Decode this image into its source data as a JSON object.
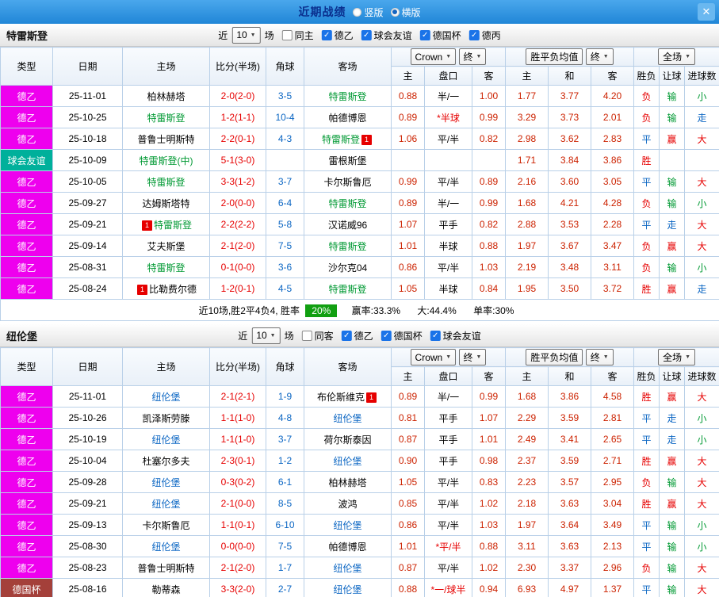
{
  "titlebar": {
    "title": "近期战绩",
    "radios": [
      {
        "label": "竖版",
        "checked": false
      },
      {
        "label": "横版",
        "checked": true
      }
    ],
    "close_label": "✕"
  },
  "columns": {
    "type": "类型",
    "date": "日期",
    "home": "主场",
    "score": "比分(半场)",
    "corner": "角球",
    "away": "客场",
    "company": "Crown",
    "final": "终",
    "europe": "胜平负均值",
    "full": "全场",
    "o_home": "主",
    "o_hcp": "盘口",
    "o_away": "客",
    "e_home": "主",
    "e_draw": "和",
    "e_away": "客",
    "r1": "胜负",
    "r2": "让球",
    "r3": "进球数"
  },
  "sections": [
    {
      "team": "特雷斯登",
      "filters": {
        "near": "近",
        "count": "10",
        "games": "场",
        "checks": [
          {
            "label": "同主",
            "on": false
          },
          {
            "label": "德乙",
            "on": true
          },
          {
            "label": "球会友谊",
            "on": true
          },
          {
            "label": "德国杯",
            "on": true
          },
          {
            "label": "德丙",
            "on": true
          }
        ]
      },
      "rows": [
        {
          "type": "德乙",
          "tc": "de2",
          "date": "25-11-01",
          "home": {
            "n": "柏林赫塔"
          },
          "score": "2-0(2-0)",
          "corner": "3-5",
          "away": {
            "n": "特雷斯登",
            "c": "team-home"
          },
          "ah": [
            "0.88",
            "半/一",
            "1.00"
          ],
          "eu": [
            "1.77",
            "3.77",
            "4.20"
          ],
          "res": [
            [
              "负",
              "r"
            ],
            [
              "输",
              "g"
            ],
            [
              "小",
              "g"
            ]
          ]
        },
        {
          "type": "德乙",
          "tc": "de2",
          "date": "25-10-25",
          "home": {
            "n": "特雷斯登",
            "c": "team-home"
          },
          "score": "1-2(1-1)",
          "corner": "10-4",
          "away": {
            "n": "帕德博恩"
          },
          "ah": [
            "0.89",
            "*半球",
            "0.99"
          ],
          "eu": [
            "3.29",
            "3.73",
            "2.01"
          ],
          "res": [
            [
              "负",
              "r"
            ],
            [
              "输",
              "g"
            ],
            [
              "走",
              "b"
            ]
          ]
        },
        {
          "type": "德乙",
          "tc": "de2",
          "date": "25-10-18",
          "home": {
            "n": "普鲁士明斯特"
          },
          "score": "2-2(0-1)",
          "corner": "4-3",
          "away": {
            "n": "特雷斯登",
            "c": "team-home",
            "b": "1",
            "bp": "after"
          },
          "ah": [
            "1.06",
            "平/半",
            "0.82"
          ],
          "eu": [
            "2.98",
            "3.62",
            "2.83"
          ],
          "res": [
            [
              "平",
              "b"
            ],
            [
              "赢",
              "r"
            ],
            [
              "大",
              "r"
            ]
          ]
        },
        {
          "type": "球会友谊",
          "tc": "friendly",
          "date": "25-10-09",
          "home": {
            "n": "特雷斯登(中)",
            "c": "team-home"
          },
          "score": "5-1(3-0)",
          "corner": "",
          "away": {
            "n": "雷根斯堡"
          },
          "ah": [
            "",
            "",
            ""
          ],
          "eu": [
            "1.71",
            "3.84",
            "3.86"
          ],
          "res": [
            [
              "胜",
              "r"
            ],
            [
              "",
              ""
            ],
            [
              "",
              ""
            ]
          ]
        },
        {
          "type": "德乙",
          "tc": "de2",
          "date": "25-10-05",
          "home": {
            "n": "特雷斯登",
            "c": "team-home"
          },
          "score": "3-3(1-2)",
          "corner": "3-7",
          "away": {
            "n": "卡尔斯鲁厄"
          },
          "ah": [
            "0.99",
            "平/半",
            "0.89"
          ],
          "eu": [
            "2.16",
            "3.60",
            "3.05"
          ],
          "res": [
            [
              "平",
              "b"
            ],
            [
              "输",
              "g"
            ],
            [
              "大",
              "r"
            ]
          ]
        },
        {
          "type": "德乙",
          "tc": "de2",
          "date": "25-09-27",
          "home": {
            "n": "达姆斯塔特"
          },
          "score": "2-0(0-0)",
          "corner": "6-4",
          "away": {
            "n": "特雷斯登",
            "c": "team-home"
          },
          "ah": [
            "0.89",
            "半/一",
            "0.99"
          ],
          "eu": [
            "1.68",
            "4.21",
            "4.28"
          ],
          "res": [
            [
              "负",
              "r"
            ],
            [
              "输",
              "g"
            ],
            [
              "小",
              "g"
            ]
          ]
        },
        {
          "type": "德乙",
          "tc": "de2",
          "date": "25-09-21",
          "home": {
            "n": "特雷斯登",
            "c": "team-home",
            "b": "1",
            "bp": "before"
          },
          "score": "2-2(2-2)",
          "corner": "5-8",
          "away": {
            "n": "汉诺威96"
          },
          "ah": [
            "1.07",
            "平手",
            "0.82"
          ],
          "eu": [
            "2.88",
            "3.53",
            "2.28"
          ],
          "res": [
            [
              "平",
              "b"
            ],
            [
              "走",
              "b"
            ],
            [
              "大",
              "r"
            ]
          ]
        },
        {
          "type": "德乙",
          "tc": "de2",
          "date": "25-09-14",
          "home": {
            "n": "艾夫斯堡"
          },
          "score": "2-1(2-0)",
          "corner": "7-5",
          "away": {
            "n": "特雷斯登",
            "c": "team-home"
          },
          "ah": [
            "1.01",
            "半球",
            "0.88"
          ],
          "eu": [
            "1.97",
            "3.67",
            "3.47"
          ],
          "res": [
            [
              "负",
              "r"
            ],
            [
              "赢",
              "r"
            ],
            [
              "大",
              "r"
            ]
          ]
        },
        {
          "type": "德乙",
          "tc": "de2",
          "date": "25-08-31",
          "home": {
            "n": "特雷斯登",
            "c": "team-home"
          },
          "score": "0-1(0-0)",
          "corner": "3-6",
          "away": {
            "n": "沙尔克04"
          },
          "ah": [
            "0.86",
            "平/半",
            "1.03"
          ],
          "eu": [
            "2.19",
            "3.48",
            "3.11"
          ],
          "res": [
            [
              "负",
              "r"
            ],
            [
              "输",
              "g"
            ],
            [
              "小",
              "g"
            ]
          ]
        },
        {
          "type": "德乙",
          "tc": "de2",
          "date": "25-08-24",
          "home": {
            "n": "比勒费尔德",
            "b": "1",
            "bp": "before"
          },
          "score": "1-2(0-1)",
          "corner": "4-5",
          "away": {
            "n": "特雷斯登",
            "c": "team-home"
          },
          "ah": [
            "1.05",
            "半球",
            "0.84"
          ],
          "eu": [
            "1.95",
            "3.50",
            "3.72"
          ],
          "res": [
            [
              "胜",
              "r"
            ],
            [
              "赢",
              "r"
            ],
            [
              "走",
              "b"
            ]
          ]
        }
      ],
      "summary": {
        "prefix": "近10场,胜2平4负4, 胜率",
        "rate": "20%",
        "stats": [
          "赢率:33.3%",
          "大:44.4%",
          "单率:30%"
        ]
      }
    },
    {
      "team": "纽伦堡",
      "filters": {
        "near": "近",
        "count": "10",
        "games": "场",
        "checks": [
          {
            "label": "同客",
            "on": false
          },
          {
            "label": "德乙",
            "on": true
          },
          {
            "label": "德国杯",
            "on": true
          },
          {
            "label": "球会友谊",
            "on": true
          }
        ]
      },
      "rows": [
        {
          "type": "德乙",
          "tc": "de2",
          "date": "25-11-01",
          "home": {
            "n": "纽伦堡",
            "c": "team-away"
          },
          "score": "2-1(2-1)",
          "corner": "1-9",
          "away": {
            "n": "布伦斯维克",
            "b": "1",
            "bp": "after"
          },
          "ah": [
            "0.89",
            "半/一",
            "0.99"
          ],
          "eu": [
            "1.68",
            "3.86",
            "4.58"
          ],
          "res": [
            [
              "胜",
              "r"
            ],
            [
              "赢",
              "r"
            ],
            [
              "大",
              "r"
            ]
          ]
        },
        {
          "type": "德乙",
          "tc": "de2",
          "date": "25-10-26",
          "home": {
            "n": "凯泽斯劳滕"
          },
          "score": "1-1(1-0)",
          "corner": "4-8",
          "away": {
            "n": "纽伦堡",
            "c": "team-away"
          },
          "ah": [
            "0.81",
            "平手",
            "1.07"
          ],
          "eu": [
            "2.29",
            "3.59",
            "2.81"
          ],
          "res": [
            [
              "平",
              "b"
            ],
            [
              "走",
              "b"
            ],
            [
              "小",
              "g"
            ]
          ]
        },
        {
          "type": "德乙",
          "tc": "de2",
          "date": "25-10-19",
          "home": {
            "n": "纽伦堡",
            "c": "team-away"
          },
          "score": "1-1(1-0)",
          "corner": "3-7",
          "away": {
            "n": "荷尔斯泰因"
          },
          "ah": [
            "0.87",
            "平手",
            "1.01"
          ],
          "eu": [
            "2.49",
            "3.41",
            "2.65"
          ],
          "res": [
            [
              "平",
              "b"
            ],
            [
              "走",
              "b"
            ],
            [
              "小",
              "g"
            ]
          ]
        },
        {
          "type": "德乙",
          "tc": "de2",
          "date": "25-10-04",
          "home": {
            "n": "杜塞尔多夫"
          },
          "score": "2-3(0-1)",
          "corner": "1-2",
          "away": {
            "n": "纽伦堡",
            "c": "team-away"
          },
          "ah": [
            "0.90",
            "平手",
            "0.98"
          ],
          "eu": [
            "2.37",
            "3.59",
            "2.71"
          ],
          "res": [
            [
              "胜",
              "r"
            ],
            [
              "赢",
              "r"
            ],
            [
              "大",
              "r"
            ]
          ]
        },
        {
          "type": "德乙",
          "tc": "de2",
          "date": "25-09-28",
          "home": {
            "n": "纽伦堡",
            "c": "team-away"
          },
          "score": "0-3(0-2)",
          "corner": "6-1",
          "away": {
            "n": "柏林赫塔"
          },
          "ah": [
            "1.05",
            "平/半",
            "0.83"
          ],
          "eu": [
            "2.23",
            "3.57",
            "2.95"
          ],
          "res": [
            [
              "负",
              "r"
            ],
            [
              "输",
              "g"
            ],
            [
              "大",
              "r"
            ]
          ]
        },
        {
          "type": "德乙",
          "tc": "de2",
          "date": "25-09-21",
          "home": {
            "n": "纽伦堡",
            "c": "team-away"
          },
          "score": "2-1(0-0)",
          "corner": "8-5",
          "away": {
            "n": "波鸿"
          },
          "ah": [
            "0.85",
            "平/半",
            "1.02"
          ],
          "eu": [
            "2.18",
            "3.63",
            "3.04"
          ],
          "res": [
            [
              "胜",
              "r"
            ],
            [
              "赢",
              "r"
            ],
            [
              "大",
              "r"
            ]
          ]
        },
        {
          "type": "德乙",
          "tc": "de2",
          "date": "25-09-13",
          "home": {
            "n": "卡尔斯鲁厄"
          },
          "score": "1-1(0-1)",
          "corner": "6-10",
          "away": {
            "n": "纽伦堡",
            "c": "team-away"
          },
          "ah": [
            "0.86",
            "平/半",
            "1.03"
          ],
          "eu": [
            "1.97",
            "3.64",
            "3.49"
          ],
          "res": [
            [
              "平",
              "b"
            ],
            [
              "输",
              "g"
            ],
            [
              "小",
              "g"
            ]
          ]
        },
        {
          "type": "德乙",
          "tc": "de2",
          "date": "25-08-30",
          "home": {
            "n": "纽伦堡",
            "c": "team-away"
          },
          "score": "0-0(0-0)",
          "corner": "7-5",
          "away": {
            "n": "帕德博恩"
          },
          "ah": [
            "1.01",
            "*平/半",
            "0.88"
          ],
          "eu": [
            "3.11",
            "3.63",
            "2.13"
          ],
          "res": [
            [
              "平",
              "b"
            ],
            [
              "输",
              "g"
            ],
            [
              "小",
              "g"
            ]
          ]
        },
        {
          "type": "德乙",
          "tc": "de2",
          "date": "25-08-23",
          "home": {
            "n": "普鲁士明斯特"
          },
          "score": "2-1(2-0)",
          "corner": "1-7",
          "away": {
            "n": "纽伦堡",
            "c": "team-away"
          },
          "ah": [
            "0.87",
            "平/半",
            "1.02"
          ],
          "eu": [
            "2.30",
            "3.37",
            "2.96"
          ],
          "res": [
            [
              "负",
              "r"
            ],
            [
              "输",
              "g"
            ],
            [
              "大",
              "r"
            ]
          ]
        },
        {
          "type": "德国杯",
          "tc": "cup",
          "date": "25-08-16",
          "home": {
            "n": "勒蒂森"
          },
          "score": "3-3(2-0)",
          "corner": "2-7",
          "away": {
            "n": "纽伦堡",
            "c": "team-away"
          },
          "ah": [
            "0.88",
            "*一/球半",
            "0.94"
          ],
          "eu": [
            "6.93",
            "4.97",
            "1.37"
          ],
          "res": [
            [
              "平",
              "b"
            ],
            [
              "输",
              "g"
            ],
            [
              "大",
              "r"
            ]
          ]
        }
      ]
    }
  ]
}
